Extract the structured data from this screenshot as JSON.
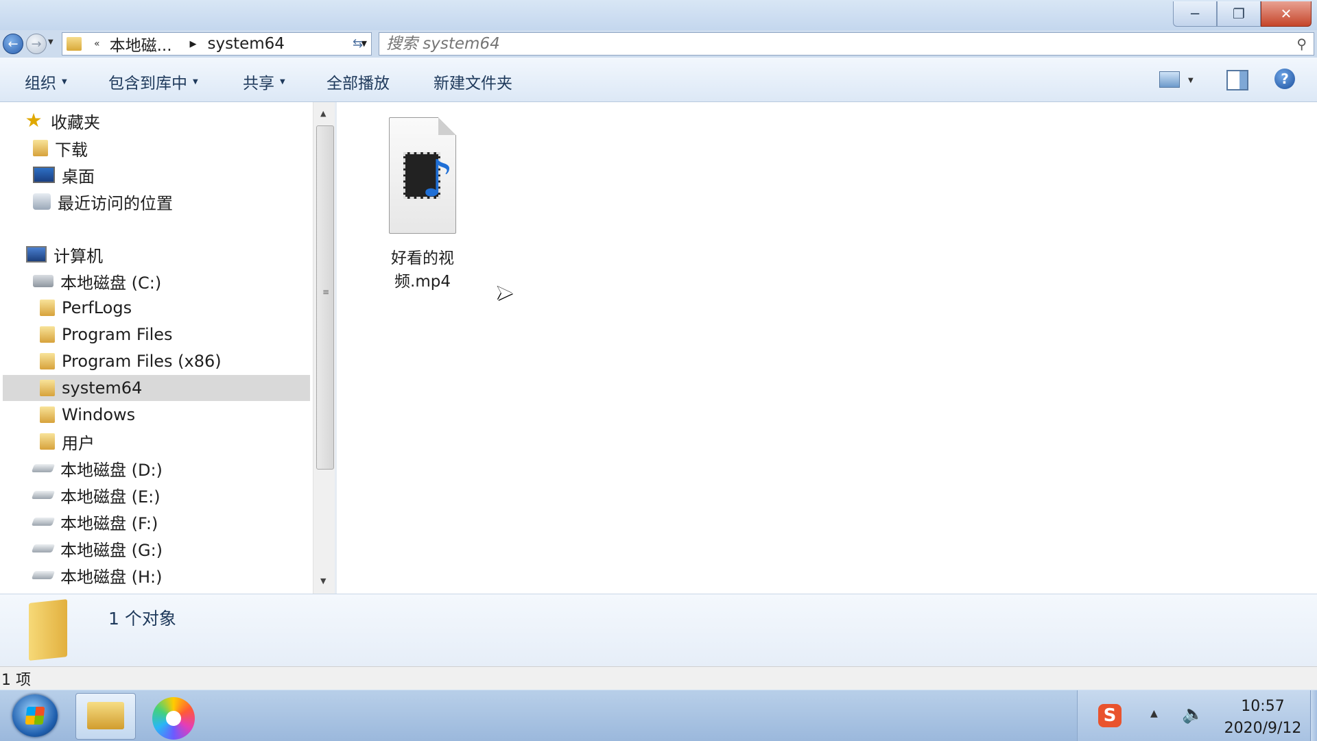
{
  "window": {
    "buttons": {
      "minimize": "─",
      "restore": "❐",
      "close": "✕"
    }
  },
  "address": {
    "breadcrumb_overflow": "«",
    "crumb1": "本地磁...",
    "crumb2": "system64",
    "search_placeholder": "搜索 system64"
  },
  "toolbar": {
    "organize": "组织",
    "include_library": "包含到库中",
    "share": "共享",
    "play_all": "全部播放",
    "new_folder": "新建文件夹"
  },
  "nav": {
    "favorites": "收藏夹",
    "downloads": "下载",
    "desktop": "桌面",
    "recent": "最近访问的位置",
    "computer": "计算机",
    "drive_c": "本地磁盘 (C:)",
    "folders": [
      "PerfLogs",
      "Program Files",
      "Program Files (x86)",
      "system64",
      "Windows",
      "用户"
    ],
    "drives": [
      "本地磁盘 (D:)",
      "本地磁盘 (E:)",
      "本地磁盘 (F:)",
      "本地磁盘 (G:)",
      "本地磁盘 (H:)"
    ],
    "selected": "system64"
  },
  "content": {
    "files": [
      {
        "name": "好看的视频.mp4",
        "icon": "media-file-icon"
      }
    ]
  },
  "details": {
    "text": "1 个对象"
  },
  "status": {
    "text": "1 项"
  },
  "taskbar": {
    "ime": "S",
    "time": "10:57",
    "date": "2020/9/12"
  }
}
